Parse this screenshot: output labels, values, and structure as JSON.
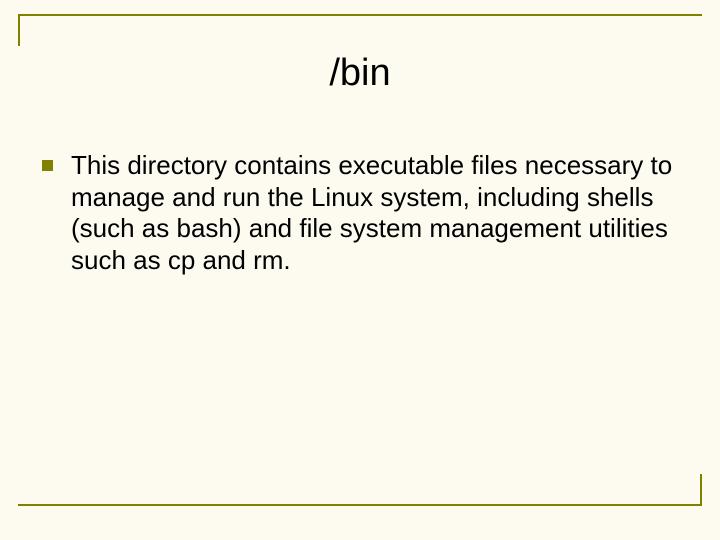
{
  "slide": {
    "title": "/bin",
    "bullets": [
      "This directory contains executable files necessary to manage and run the Linux system, including shells (such as bash) and file system management utilities such as cp and rm."
    ]
  },
  "colors": {
    "accent": "#818100",
    "background": "#fdfaf0"
  }
}
